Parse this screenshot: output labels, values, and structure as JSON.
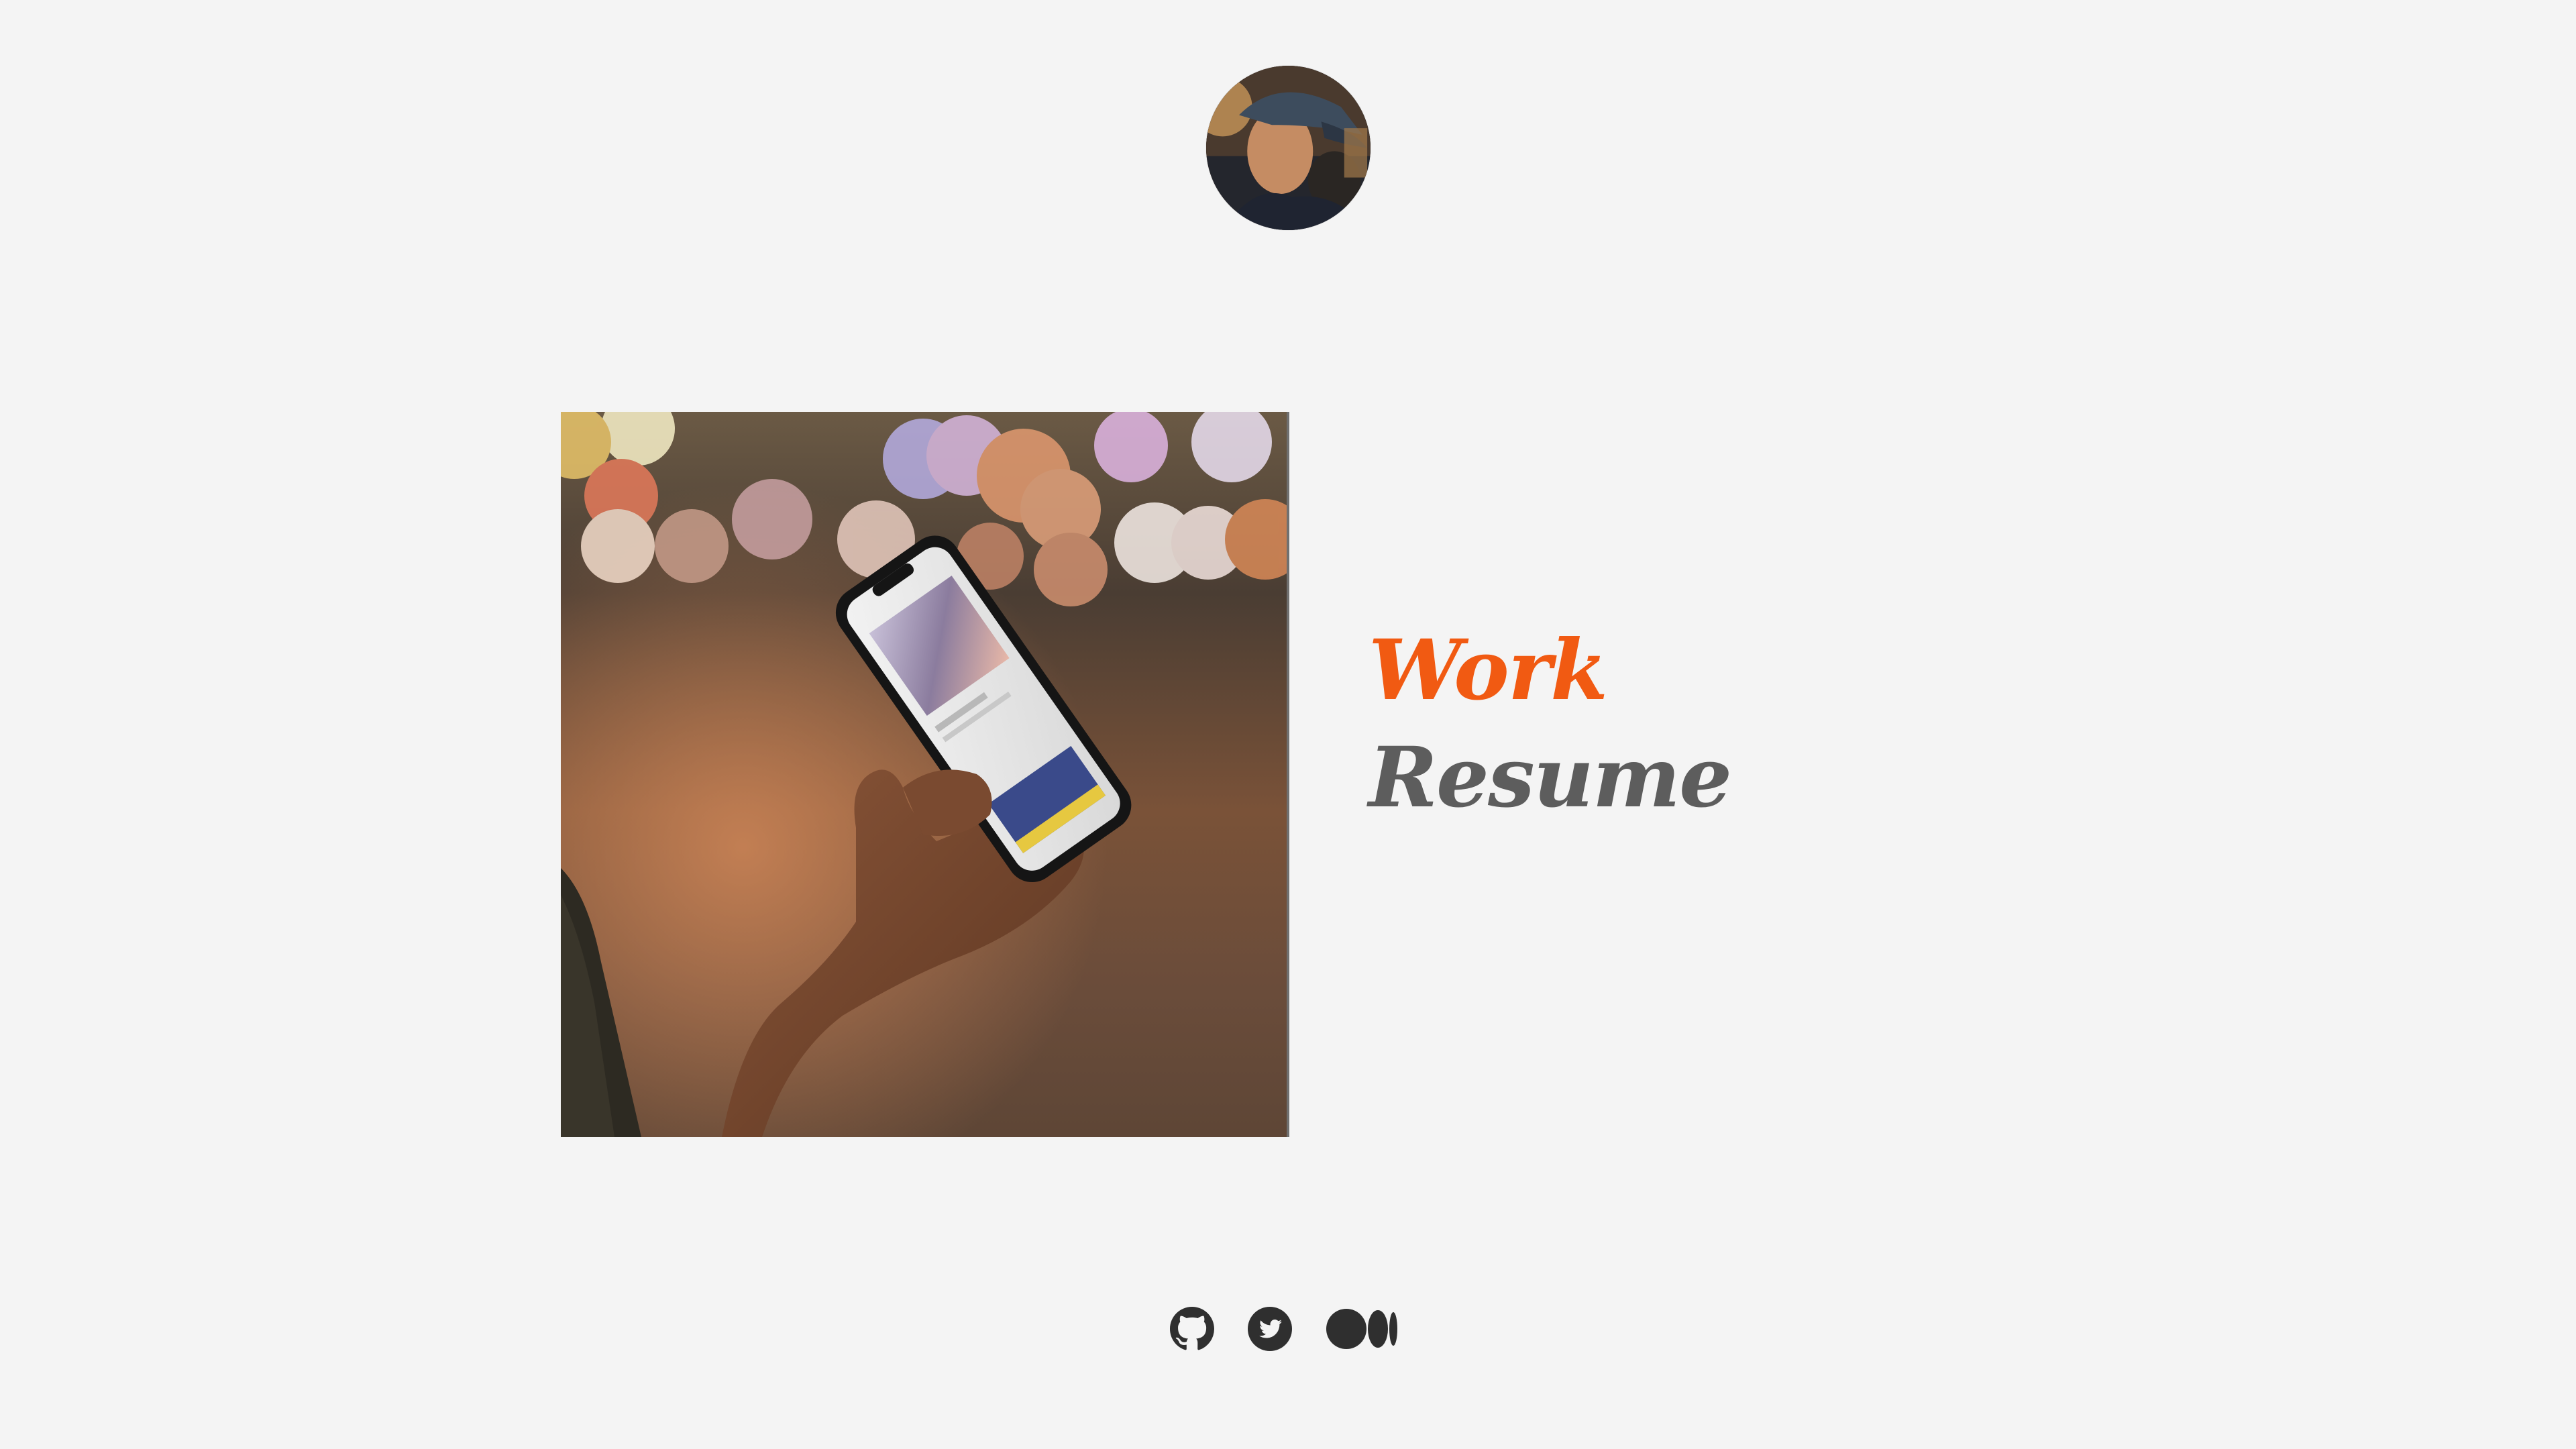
{
  "profile": {
    "avatar_icon": "avatar-photo"
  },
  "hero": {
    "image_icon": "phone-in-hand-bokeh-photo"
  },
  "nav": {
    "work_label": "Work",
    "resume_label": "Resume"
  },
  "social": {
    "github_icon": "github-icon",
    "twitter_icon": "twitter-icon",
    "medium_icon": "medium-icon"
  },
  "colors": {
    "background": "#f4f4f4",
    "accent": "#f15a12",
    "secondary_text": "#5d5d5d",
    "icon": "#2f2f2f"
  }
}
